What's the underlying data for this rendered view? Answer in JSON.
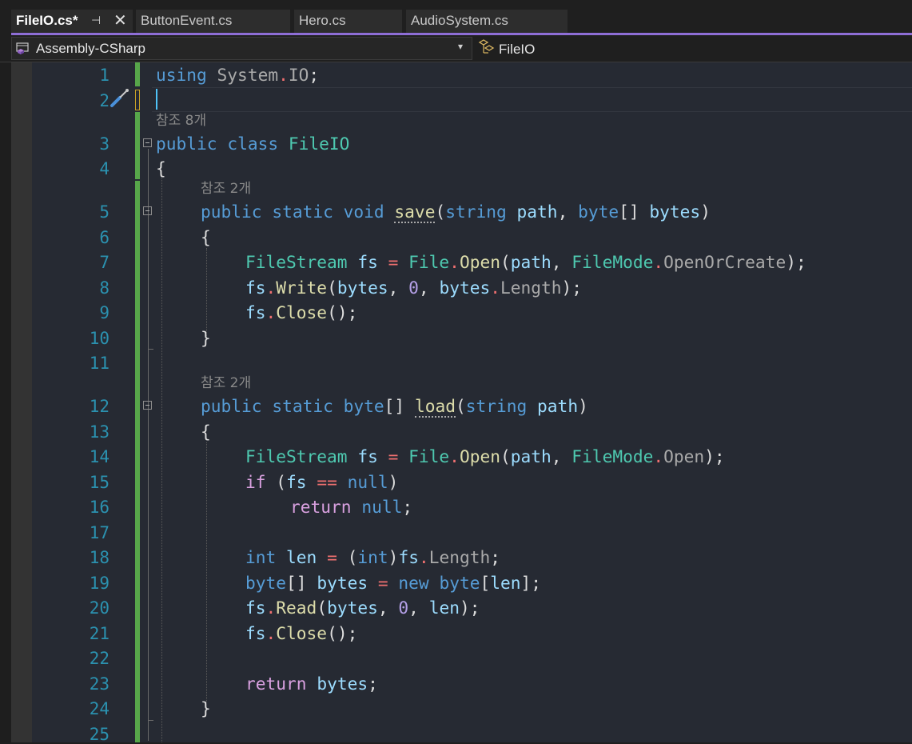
{
  "tabs": [
    {
      "label": "FileIO.cs*",
      "active": true,
      "pinned_icon": "pin-icon",
      "close": "✕"
    },
    {
      "label": "ButtonEvent.cs",
      "active": false
    },
    {
      "label": "Hero.cs",
      "active": false
    },
    {
      "label": "AudioSystem.cs",
      "active": false
    }
  ],
  "nav": {
    "project": "Assembly-CSharp",
    "type": "FileIO",
    "dropdown_glyph": "▾"
  },
  "editor": {
    "line_numbers": [
      "1",
      "2",
      "3",
      "4",
      "5",
      "6",
      "7",
      "8",
      "9",
      "10",
      "11",
      "12",
      "13",
      "14",
      "15",
      "16",
      "17",
      "18",
      "19",
      "20",
      "21",
      "22",
      "23",
      "24",
      "25"
    ],
    "codelens": {
      "class_refs": "참조 8개",
      "save_refs": "참조 2개",
      "load_refs": "참조 2개"
    }
  },
  "colors": {
    "accent": "#8e6ed6",
    "keyword": "#569cd6",
    "control_keyword": "#d8a0df",
    "type": "#4ec9b0",
    "method": "#dcdcaa",
    "variable": "#9cdcfe",
    "line_number": "#2b91af",
    "change_bar": "#57a64a"
  }
}
